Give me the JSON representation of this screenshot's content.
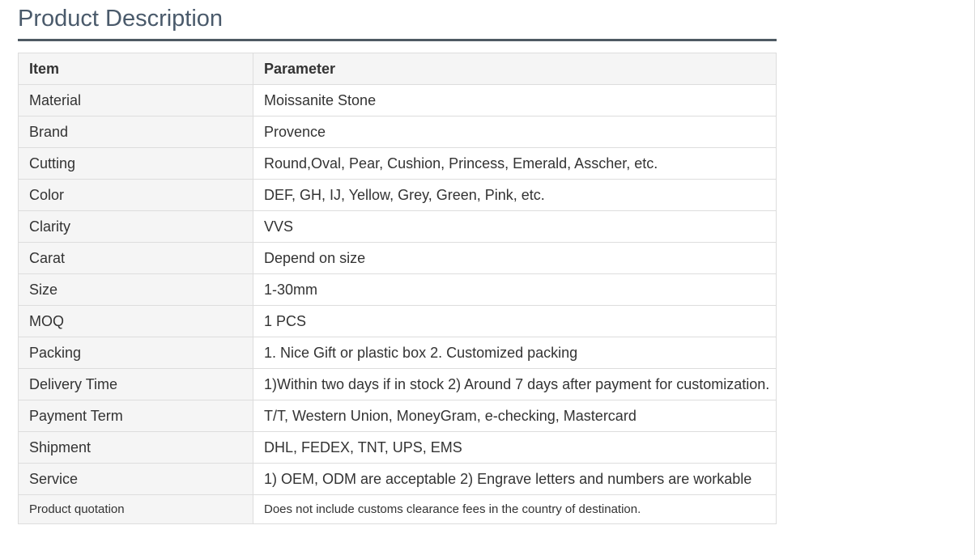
{
  "section": {
    "title": "Product Description"
  },
  "table": {
    "headers": [
      "Item",
      "Parameter"
    ],
    "rows": [
      [
        "Material",
        "Moissanite Stone"
      ],
      [
        "Brand",
        "Provence"
      ],
      [
        "Cutting",
        "Round,Oval, Pear, Cushion, Princess, Emerald, Asscher, etc."
      ],
      [
        "Color",
        "DEF, GH, IJ, Yellow, Grey, Green, Pink, etc."
      ],
      [
        "Clarity",
        "VVS"
      ],
      [
        "Carat",
        "Depend on size"
      ],
      [
        "Size",
        "1-30mm"
      ],
      [
        "MOQ",
        "1 PCS"
      ],
      [
        "Packing",
        "1. Nice Gift or plastic box 2. Customized packing"
      ],
      [
        "Delivery Time",
        "1)Within two days if in stock 2) Around 7 days after payment for customization."
      ],
      [
        "Payment Term",
        "T/T, Western Union, MoneyGram, e-checking, Mastercard"
      ],
      [
        "Shipment",
        "DHL, FEDEX, TNT, UPS, EMS"
      ],
      [
        "Service",
        "1) OEM, ODM are acceptable 2) Engrave letters and numbers are workable"
      ],
      [
        "Product quotation",
        "Does not include customs clearance fees in the country of destination."
      ]
    ]
  }
}
